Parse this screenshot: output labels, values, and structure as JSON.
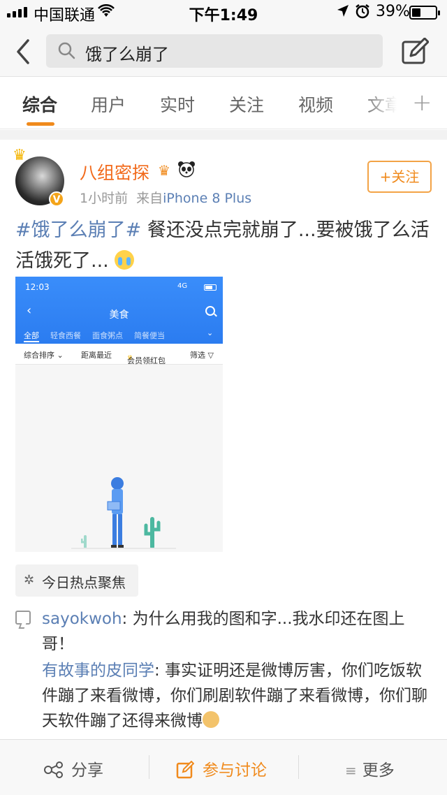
{
  "status_bar": {
    "carrier": "中国联通",
    "time": "下午1:49",
    "battery": "39%",
    "battery_level": 0.39,
    "icons": [
      "signal-icon",
      "wifi-icon",
      "location-icon",
      "alarm-icon",
      "battery-icon"
    ]
  },
  "search": {
    "query": "饿了么崩了",
    "icons": [
      "back-icon",
      "search-icon",
      "compose-icon"
    ]
  },
  "tabs": [
    {
      "label": "综合",
      "active": true
    },
    {
      "label": "用户"
    },
    {
      "label": "实时"
    },
    {
      "label": "关注"
    },
    {
      "label": "视频"
    },
    {
      "label": "文章"
    }
  ],
  "tabs_more": "+",
  "post": {
    "username": "八组密探",
    "time": "1小时前",
    "source_prefix": "来自",
    "source": "iPhone 8 Plus",
    "follow_label": "+关注",
    "hashtag": "#饿了么崩了#",
    "text": " 餐还没点完就崩了...要被饿了么活活饿死了... ",
    "verified": "V",
    "image": {
      "time": "12:03",
      "network": "4G",
      "title": "美食",
      "tabs": [
        "全部",
        "轻食西餐",
        "面食粥点",
        "简餐便当"
      ],
      "filters": [
        "综合排序 ⌄",
        "距离最近",
        "会员领红包",
        "筛选 ▽"
      ]
    }
  },
  "topic": {
    "label": "今日热点聚焦"
  },
  "comments": [
    {
      "author": "sayokwoh",
      "text": ": 为什么用我的图和字...我水印还在图上哥！"
    },
    {
      "author": "有故事的皮同学",
      "text": ": 事实证明还是微博厉害，你们吃饭软件蹦了来看微博，你们刷剧软件蹦了来看微博，你们聊天软件蹦了还得来微博"
    }
  ],
  "bottom_bar": {
    "share": "分享",
    "discuss": "参与讨论",
    "more": "更多"
  },
  "colors": {
    "accent": "#f08a1c",
    "link": "#5b7fb4",
    "username": "#f26a1b"
  }
}
